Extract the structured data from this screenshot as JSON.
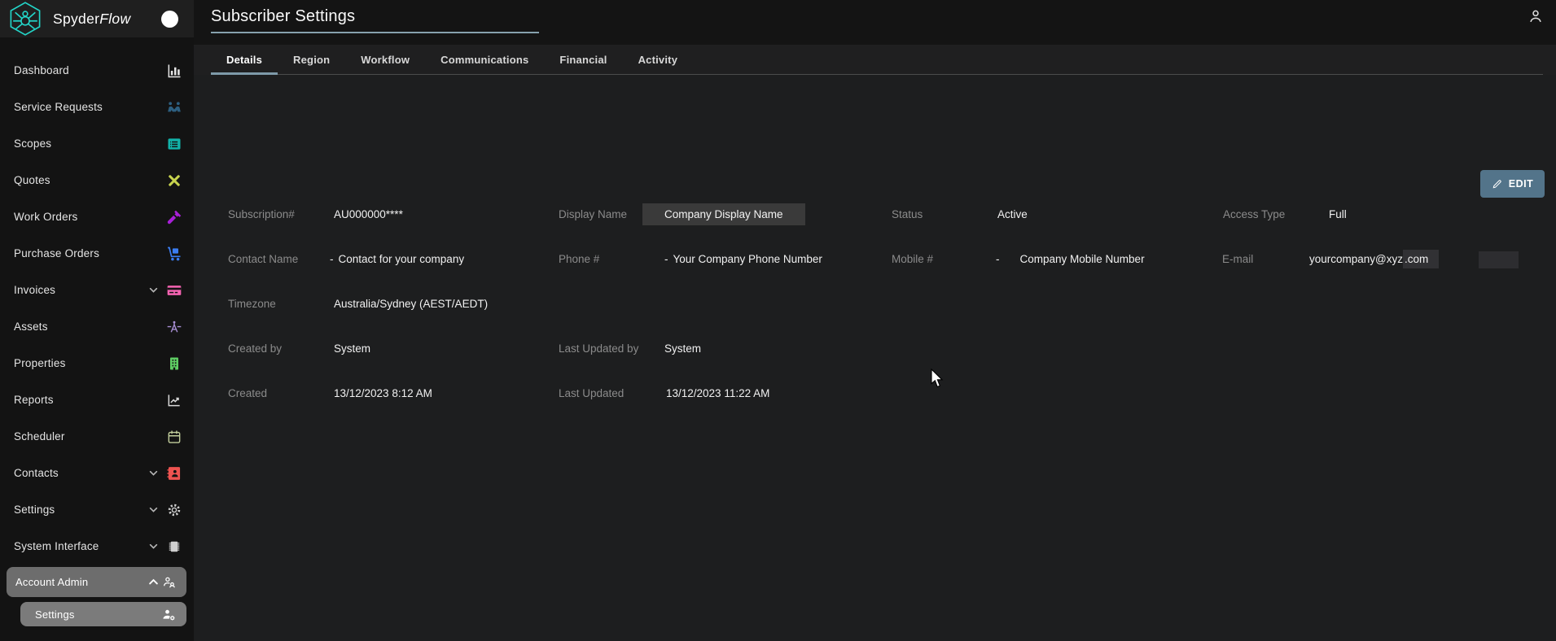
{
  "brand": {
    "name_regular": "Spyder",
    "name_italic": "Flow",
    "accent_color": "#23d5c8"
  },
  "topbar": {
    "title": "Subscriber Settings"
  },
  "tabs": [
    {
      "label": "Details",
      "active": true
    },
    {
      "label": "Region",
      "active": false
    },
    {
      "label": "Workflow",
      "active": false
    },
    {
      "label": "Communications",
      "active": false
    },
    {
      "label": "Financial",
      "active": false
    },
    {
      "label": "Activity",
      "active": false
    }
  ],
  "edit_button": {
    "label": "EDIT",
    "icon": "pencil-icon",
    "color": "#53748a"
  },
  "sidebar": {
    "items": [
      {
        "label": "Dashboard",
        "icon": "bar-chart-icon",
        "color": "#e6e6e6",
        "expandable": false
      },
      {
        "label": "Service Requests",
        "icon": "people-handshake-icon",
        "color": "#2d5f80",
        "expandable": false
      },
      {
        "label": "Scopes",
        "icon": "list-box-icon",
        "color": "#12b3aa",
        "expandable": false
      },
      {
        "label": "Quotes",
        "icon": "design-tools-icon",
        "color": "#c8d44e",
        "expandable": false
      },
      {
        "label": "Work Orders",
        "icon": "hammer-icon",
        "color": "#a820d8",
        "expandable": false
      },
      {
        "label": "Purchase Orders",
        "icon": "dolly-icon",
        "color": "#3b7df2",
        "expandable": false
      },
      {
        "label": "Invoices",
        "icon": "credit-card-icon",
        "color": "#f463b1",
        "expandable": true
      },
      {
        "label": "Assets",
        "icon": "asset-antenna-icon",
        "color": "#a78ed3",
        "expandable": false
      },
      {
        "label": "Properties",
        "icon": "building-icon",
        "color": "#5ecc63",
        "expandable": false
      },
      {
        "label": "Reports",
        "icon": "line-chart-icon",
        "color": "#d9d9d9",
        "expandable": false
      },
      {
        "label": "Scheduler",
        "icon": "calendar-icon",
        "color": "#c2ce9c",
        "expandable": false
      },
      {
        "label": "Contacts",
        "icon": "contact-book-icon",
        "color": "#ee5350",
        "expandable": true
      },
      {
        "label": "Settings",
        "icon": "gear-icon",
        "color": "#cfcfcf",
        "expandable": true
      },
      {
        "label": "System Interface",
        "icon": "chip-icon",
        "color": "#cfcfcf",
        "expandable": true
      }
    ],
    "account_admin": {
      "label": "Account Admin",
      "icon": "manage-accounts-icon",
      "expanded": true
    },
    "account_admin_settings": {
      "label": "Settings",
      "icon": "person-gear-icon"
    }
  },
  "details": {
    "fields": [
      {
        "id": "subscription",
        "label": "Subscription#",
        "value": "AU000000****"
      },
      {
        "id": "display_name",
        "label": "Display Name",
        "value": "Company Display Name",
        "boxed": true
      },
      {
        "id": "status",
        "label": "Status",
        "value": "Active"
      },
      {
        "id": "access_type",
        "label": "Access Type",
        "value": "Full"
      },
      {
        "id": "contact_name",
        "label": "Contact Name",
        "prefix": "-",
        "value": "Contact for your company"
      },
      {
        "id": "phone",
        "label": "Phone #",
        "prefix": "-",
        "value": "Your Company Phone Number"
      },
      {
        "id": "mobile",
        "label": "Mobile #",
        "prefix": "-",
        "value": "Company Mobile Number",
        "wide_gap": true
      },
      {
        "id": "email",
        "label": "E-mail",
        "value_main": "yourcompany@xyz",
        "value_tail": ".com"
      },
      {
        "id": "timezone",
        "label": "Timezone",
        "value": "Australia/Sydney (AEST/AEDT)"
      },
      {
        "id": "created_by",
        "label": "Created by",
        "value": "System"
      },
      {
        "id": "last_updated_by",
        "label": "Last Updated by",
        "value": "System"
      },
      {
        "id": "created",
        "label": "Created",
        "value": "13/12/2023 8:12 AM"
      },
      {
        "id": "last_updated",
        "label": "Last Updated",
        "value": "13/12/2023 11:22 AM"
      }
    ]
  }
}
